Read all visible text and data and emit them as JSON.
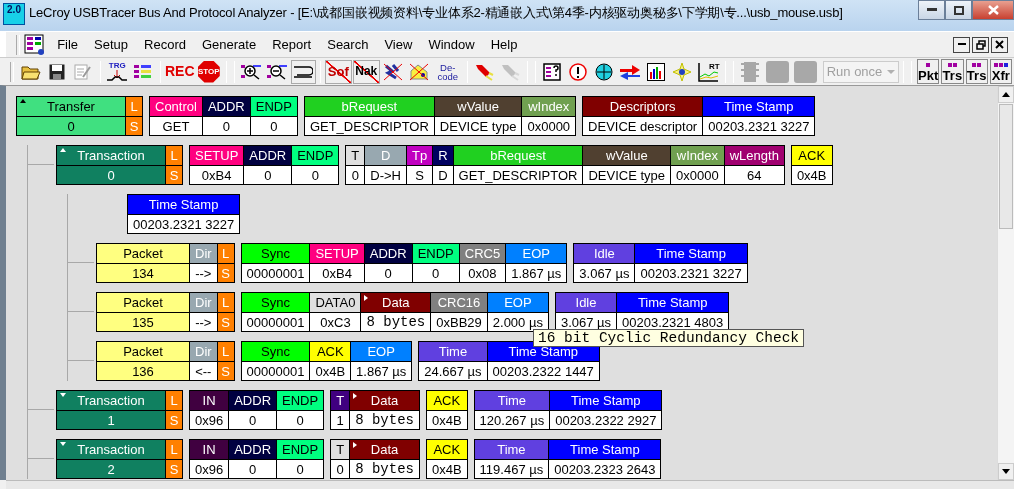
{
  "window": {
    "title": "LeCroy USBTracer Bus And Protocol Analyzer - [E:\\成都国嵌视频资料\\专业体系2-精通嵌入式\\第4季-内核驱动奥秘多\\下学期\\专...\\usb_mouse.usb]",
    "icon_label": "2.0"
  },
  "menu": [
    "File",
    "Setup",
    "Record",
    "Generate",
    "Report",
    "Search",
    "View",
    "Window",
    "Help"
  ],
  "toolbar": {
    "trigger": "TRG",
    "record": "REC",
    "stop": "STOP",
    "hide_sof": "Sof",
    "hide_nak": "Nak",
    "decode": "De-code",
    "real_time": "RT",
    "run_mode": {
      "value": "Run once",
      "disabled": true
    },
    "views": [
      "Pkt",
      "Trs",
      "Trs",
      "Xfr"
    ]
  },
  "trace": [
    {
      "kind": "transfer",
      "groups": [
        {
          "cells": [
            {
              "kind": "title",
              "label": "Transfer",
              "value": "0",
              "color": "#40e080",
              "expanded": true
            },
            {
              "kind": "flag",
              "label": "L",
              "value": "S",
              "color": "#ff8000"
            }
          ]
        },
        {
          "cells": [
            {
              "label": "Control",
              "value": "GET",
              "color": "#ff0080"
            },
            {
              "label": "ADDR",
              "value": "0",
              "color": "#000040"
            },
            {
              "label": "ENDP",
              "value": "0",
              "color": "#00ff80"
            }
          ]
        },
        {
          "cells": [
            {
              "label": "bRequest",
              "value": "GET_DESCRIPTOR",
              "color": "#20d020"
            },
            {
              "label": "wValue",
              "value": "DEVICE type",
              "color": "#504030"
            },
            {
              "label": "wIndex",
              "value": "0x0000",
              "color": "#70a050"
            }
          ]
        },
        {
          "cells": [
            {
              "label": "Descriptors",
              "value": "DEVICE descriptor",
              "color": "#800000"
            },
            {
              "label": "Time Stamp",
              "value": "00203.2321 3227",
              "color": "#0000ff"
            }
          ]
        }
      ],
      "children": [
        {
          "kind": "transaction",
          "groups": [
            {
              "cells": [
                {
                  "kind": "title",
                  "label": "Transaction",
                  "value": "0",
                  "color": "#108060",
                  "expanded": true
                },
                {
                  "kind": "flag",
                  "label": "L",
                  "value": "S",
                  "color": "#ff8000"
                }
              ]
            },
            {
              "cells": [
                {
                  "label": "SETUP",
                  "value": "0xB4",
                  "color": "#ff0080"
                },
                {
                  "label": "ADDR",
                  "value": "0",
                  "color": "#000040"
                },
                {
                  "label": "ENDP",
                  "value": "0",
                  "color": "#00ff80"
                }
              ]
            },
            {
              "cells": [
                {
                  "label": "T",
                  "value": "0",
                  "color": "#e0e0e0"
                },
                {
                  "label": "D",
                  "value": "D->H",
                  "color": "#98a8b0"
                },
                {
                  "label": "Tp",
                  "value": "S",
                  "color": "#c000c0"
                },
                {
                  "label": "R",
                  "value": "D",
                  "color": "#000060"
                },
                {
                  "label": "bRequest",
                  "value": "GET_DESCRIPTOR",
                  "color": "#20d020"
                },
                {
                  "label": "wValue",
                  "value": "DEVICE type",
                  "color": "#504030"
                },
                {
                  "label": "wIndex",
                  "value": "0x0000",
                  "color": "#70a050"
                },
                {
                  "label": "wLength",
                  "value": "64",
                  "color": "#a00070"
                }
              ]
            },
            {
              "cells": [
                {
                  "label": "ACK",
                  "value": "0x4B",
                  "color": "#ffff00"
                }
              ]
            }
          ],
          "children": [
            {
              "kind": "continuation",
              "groups": [
                {
                  "cells": [
                    {
                      "label": "Time Stamp",
                      "value": "00203.2321 3227",
                      "color": "#0000ff"
                    }
                  ]
                }
              ]
            },
            {
              "kind": "packet",
              "groups": [
                {
                  "cells": [
                    {
                      "kind": "title",
                      "label": "Packet",
                      "value": "134",
                      "color": "#ffff80"
                    },
                    {
                      "label": "Dir",
                      "value": "-->",
                      "color": "#98a8b0"
                    },
                    {
                      "kind": "flag",
                      "label": "L",
                      "value": "S",
                      "color": "#ff8000"
                    }
                  ]
                },
                {
                  "cells": [
                    {
                      "label": "Sync",
                      "value": "00000001",
                      "color": "#00ff00"
                    },
                    {
                      "label": "SETUP",
                      "value": "0xB4",
                      "color": "#ff0080"
                    },
                    {
                      "label": "ADDR",
                      "value": "0",
                      "color": "#000040"
                    },
                    {
                      "label": "ENDP",
                      "value": "0",
                      "color": "#00ff80"
                    },
                    {
                      "label": "CRC5",
                      "value": "0x08",
                      "color": "#808080"
                    },
                    {
                      "label": "EOP",
                      "value": "1.867 µs",
                      "color": "#0080ff"
                    }
                  ]
                },
                {
                  "cells": [
                    {
                      "label": "Idle",
                      "value": "3.067 µs",
                      "color": "#6040e0"
                    },
                    {
                      "label": "Time Stamp",
                      "value": "00203.2321 3227",
                      "color": "#0000ff"
                    }
                  ]
                }
              ]
            },
            {
              "kind": "packet",
              "groups": [
                {
                  "cells": [
                    {
                      "kind": "title",
                      "label": "Packet",
                      "value": "135",
                      "color": "#ffff80"
                    },
                    {
                      "label": "Dir",
                      "value": "-->",
                      "color": "#98a8b0"
                    },
                    {
                      "kind": "flag",
                      "label": "L",
                      "value": "S",
                      "color": "#ff8000"
                    }
                  ]
                },
                {
                  "cells": [
                    {
                      "label": "Sync",
                      "value": "00000001",
                      "color": "#00ff00"
                    },
                    {
                      "label": "DATA0",
                      "value": "0xC3",
                      "color": "#e0e0e0"
                    },
                    {
                      "kind": "data",
                      "label": "Data",
                      "value": "8 bytes",
                      "color": "#800000"
                    },
                    {
                      "label": "CRC16",
                      "value": "0xBB29",
                      "color": "#808080"
                    },
                    {
                      "label": "EOP",
                      "value": "2.000 µs",
                      "color": "#0080ff"
                    }
                  ]
                },
                {
                  "cells": [
                    {
                      "label": "Idle",
                      "value": "3.067 µs",
                      "color": "#6040e0"
                    },
                    {
                      "label": "Time Stamp",
                      "value": "00203.2321 4803",
                      "color": "#0000ff"
                    }
                  ]
                }
              ]
            },
            {
              "kind": "packet",
              "groups": [
                {
                  "cells": [
                    {
                      "kind": "title",
                      "label": "Packet",
                      "value": "136",
                      "color": "#ffff80"
                    },
                    {
                      "label": "Dir",
                      "value": "<--",
                      "color": "#98a8b0"
                    },
                    {
                      "kind": "flag",
                      "label": "L",
                      "value": "S",
                      "color": "#ff8000"
                    }
                  ]
                },
                {
                  "cells": [
                    {
                      "label": "Sync",
                      "value": "00000001",
                      "color": "#00ff00"
                    },
                    {
                      "label": "ACK",
                      "value": "0x4B",
                      "color": "#ffff00"
                    },
                    {
                      "label": "EOP",
                      "value": "1.867 µs",
                      "color": "#0080ff"
                    }
                  ]
                },
                {
                  "cells": [
                    {
                      "label": "Time",
                      "value": "24.667 µs",
                      "color": "#6040e0"
                    },
                    {
                      "label": "Time Stamp",
                      "value": "00203.2322 1447",
                      "color": "#0000ff"
                    }
                  ]
                }
              ]
            }
          ]
        },
        {
          "kind": "transaction",
          "groups": [
            {
              "cells": [
                {
                  "kind": "title",
                  "label": "Transaction",
                  "value": "1",
                  "color": "#108060",
                  "expanded": false
                },
                {
                  "kind": "flag",
                  "label": "L",
                  "value": "S",
                  "color": "#ff8000"
                }
              ]
            },
            {
              "cells": [
                {
                  "label": "IN",
                  "value": "0x96",
                  "color": "#400040"
                },
                {
                  "label": "ADDR",
                  "value": "0",
                  "color": "#000040"
                },
                {
                  "label": "ENDP",
                  "value": "0",
                  "color": "#00ff80"
                }
              ]
            },
            {
              "cells": [
                {
                  "label": "T",
                  "value": "1",
                  "color": "#400080"
                },
                {
                  "kind": "data",
                  "label": "Data",
                  "value": "8 bytes",
                  "color": "#800000"
                }
              ]
            },
            {
              "cells": [
                {
                  "label": "ACK",
                  "value": "0x4B",
                  "color": "#ffff00"
                }
              ]
            },
            {
              "cells": [
                {
                  "label": "Time",
                  "value": "120.267 µs",
                  "color": "#6040e0"
                },
                {
                  "label": "Time Stamp",
                  "value": "00203.2322 2927",
                  "color": "#0000ff"
                }
              ]
            }
          ]
        },
        {
          "kind": "transaction",
          "groups": [
            {
              "cells": [
                {
                  "kind": "title",
                  "label": "Transaction",
                  "value": "2",
                  "color": "#108060",
                  "expanded": false
                },
                {
                  "kind": "flag",
                  "label": "L",
                  "value": "S",
                  "color": "#ff8000"
                }
              ]
            },
            {
              "cells": [
                {
                  "label": "IN",
                  "value": "0x96",
                  "color": "#400040"
                },
                {
                  "label": "ADDR",
                  "value": "0",
                  "color": "#000040"
                },
                {
                  "label": "ENDP",
                  "value": "0",
                  "color": "#00ff80"
                }
              ]
            },
            {
              "cells": [
                {
                  "label": "T",
                  "value": "0",
                  "color": "#e0e0e0"
                },
                {
                  "kind": "data",
                  "label": "Data",
                  "value": "8 bytes",
                  "color": "#800000"
                }
              ]
            },
            {
              "cells": [
                {
                  "label": "ACK",
                  "value": "0x4B",
                  "color": "#ffff00"
                }
              ]
            },
            {
              "cells": [
                {
                  "label": "Time",
                  "value": "119.467 µs",
                  "color": "#6040e0"
                },
                {
                  "label": "Time Stamp",
                  "value": "00203.2323 2643",
                  "color": "#0000ff"
                }
              ]
            }
          ]
        }
      ]
    }
  ],
  "tooltip": "16 bit Cyclic Redundancy Check"
}
